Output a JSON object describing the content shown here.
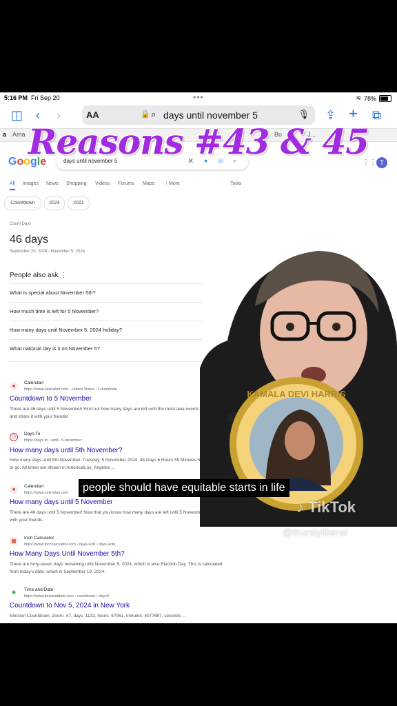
{
  "status_bar": {
    "time": "5:16 PM",
    "date": "Fri Sep 20",
    "battery": "78%"
  },
  "browser": {
    "text_size_label": "AA",
    "url_text": "days until november 5",
    "tabs": [
      "Ama",
      "Bu",
      "J..."
    ]
  },
  "overlay_title": "Reasons #43 & 45",
  "google": {
    "logo": "Google",
    "query": "days until november 5",
    "avatar_letter": "T",
    "nav_tabs": [
      "All",
      "Images",
      "News",
      "Shopping",
      "Videos",
      "Forums",
      "Maps",
      "More",
      "Tools"
    ],
    "chips": [
      "Countdown",
      "2024",
      "2021"
    ],
    "count_label": "Count Days",
    "count_value": "46 days",
    "count_range": "September 20, 2024 - November 5, 2024",
    "paa_title": "People also ask",
    "paa_items": [
      "What is special about November 5th?",
      "How much time is left for 5 November?",
      "How many days until November 5, 2024 holiday?",
      "What national day is it on November 5?"
    ],
    "results": [
      {
        "site": "Calendarr",
        "crumb": "https://www.calendarr.com › United States › Countdown",
        "title": "Countdown to 5 November",
        "desc": "There are 46 days until 5 November! Find out how many days are left until the most awa events of the year and share it with your friends!"
      },
      {
        "site": "Days To",
        "crumb": "https://days.to › until › 5-november",
        "title": "How many days until 5th November?",
        "desc": "How many days until 5th November. Tuesday, 5 November 2024. 46 Days 6 Hours 59 Minutes 55 Seconds. to go. All times are shown in America/Los_Angeles ..."
      },
      {
        "site": "Calendarr",
        "crumb": "https://www.calendarr.com",
        "title": "How many days until 5 November",
        "desc": "There are 46 days until 5 November! Now that you know how many days are left until 5 November, share it with your friends."
      },
      {
        "site": "Inch Calculator",
        "crumb": "https://www.inchcalculator.com › days-until › days-until...",
        "title": "How Many Days Until November 5th?",
        "desc": "There are forty-seven days remaining until November 5, 2024, which is also Election Day. This is calculated from today's date, which is September 19, 2024."
      },
      {
        "site": "Time and Date",
        "crumb": "https://www.timeanddate.com › countdown › day=5",
        "title": "Countdown to Nov 5, 2024 in New York",
        "desc": "Election Countdown. Zoom. 47, days. 1132, hours. 67961, minutes. 4077687, seconds ..."
      }
    ]
  },
  "badge_text": "KAMALA DEVI HARRIS",
  "caption": "people should have equitable starts in life",
  "tiktok": {
    "logo": "TikTok",
    "handle": "@thurstyliberal"
  },
  "colors": {
    "title_purple": "#a22be0",
    "link_blue": "#1a0dab",
    "ios_blue": "#1a73e8"
  }
}
